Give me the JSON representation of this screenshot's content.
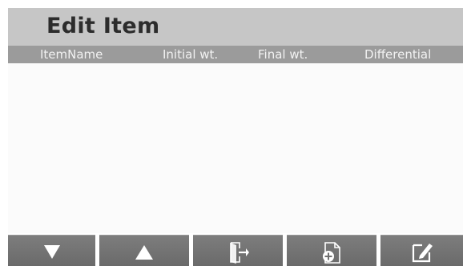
{
  "header": {
    "title": "Edit Item"
  },
  "columns": {
    "item_name": "ItemName",
    "initial_wt": "Initial wt.",
    "final_wt": "Final wt.",
    "differential": "Differential"
  },
  "items": [],
  "softkeys": [
    {
      "icon": "arrow-down-icon"
    },
    {
      "icon": "arrow-up-icon"
    },
    {
      "icon": "exit-icon"
    },
    {
      "icon": "add-document-icon"
    },
    {
      "icon": "edit-icon"
    }
  ],
  "colors": {
    "header_bg": "#c6c6c6",
    "column_bar_bg": "#9b9b9b",
    "softkey_bg": "#737373",
    "icon_color": "#ffffff"
  }
}
